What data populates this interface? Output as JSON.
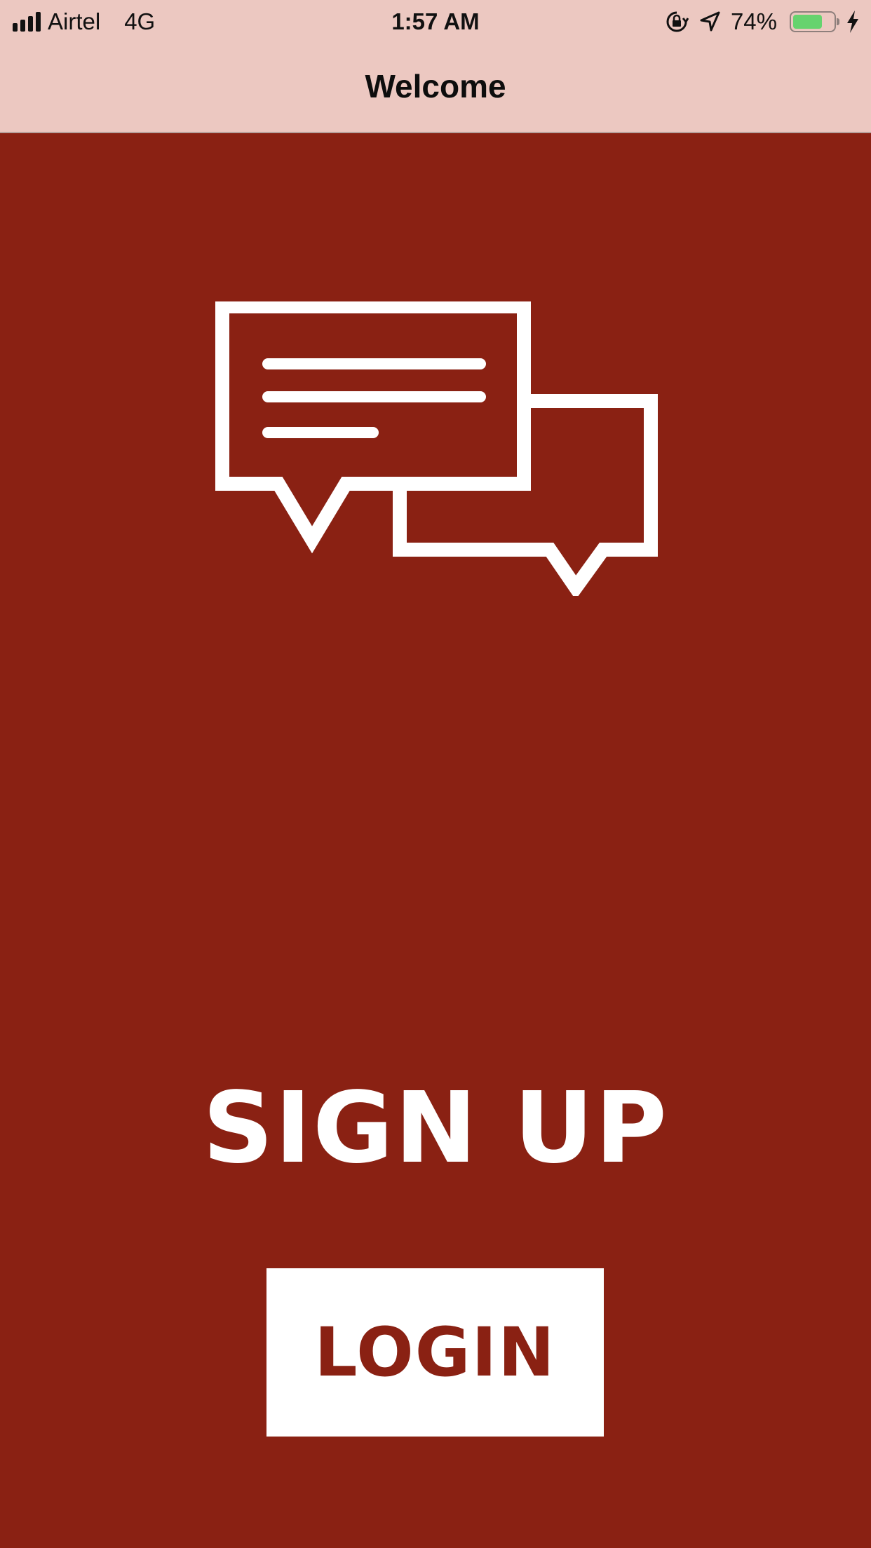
{
  "status_bar": {
    "carrier": "Airtel",
    "network": "4G",
    "time": "1:57 AM",
    "battery_percent": "74%",
    "battery_level": 0.74,
    "battery_color": "#66d36e"
  },
  "nav": {
    "title": "Welcome"
  },
  "hero": {
    "icon": "chat-bubbles-icon"
  },
  "actions": {
    "signup_label": "SIGN UP",
    "login_label": "LOGIN"
  },
  "colors": {
    "background": "#8a2113",
    "top_bar": "#ecc8c1",
    "foreground": "#ffffff"
  }
}
